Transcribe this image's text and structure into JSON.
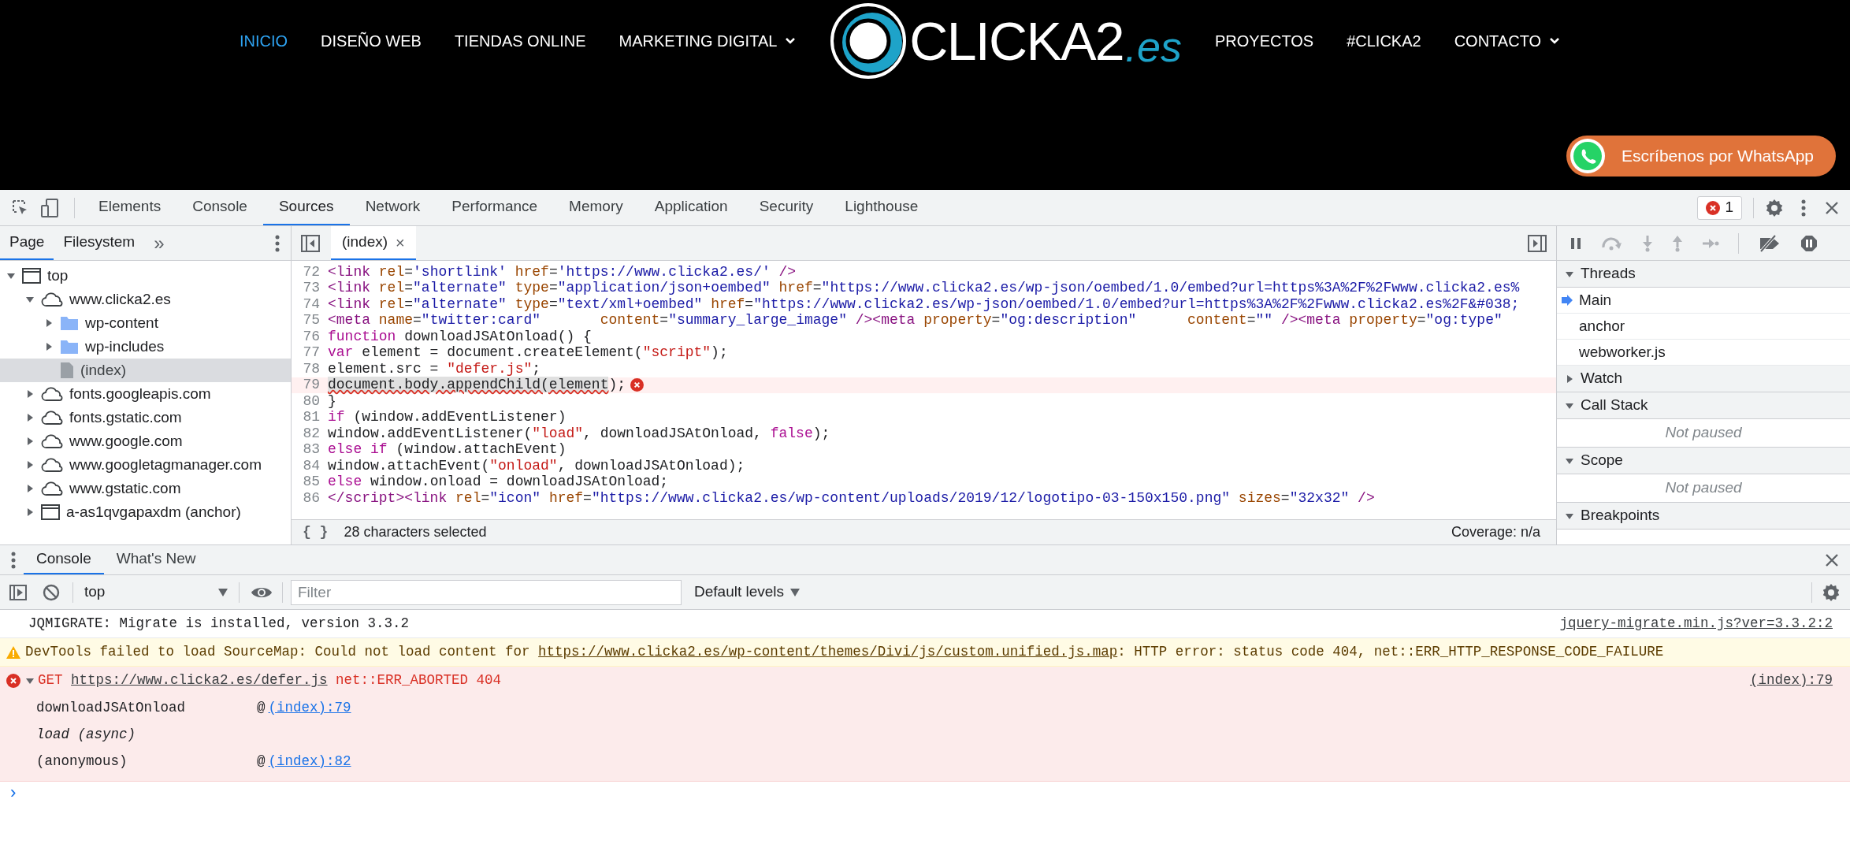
{
  "site_header": {
    "nav_left": [
      {
        "label": "INICIO",
        "selected": true,
        "has_dropdown": false
      },
      {
        "label": "DISEÑO WEB",
        "selected": false,
        "has_dropdown": false
      },
      {
        "label": "TIENDAS ONLINE",
        "selected": false,
        "has_dropdown": false
      },
      {
        "label": "MARKETING DIGITAL",
        "selected": false,
        "has_dropdown": true
      }
    ],
    "logo": {
      "name": "CLICKA2",
      "suffix": ".es"
    },
    "nav_right": [
      {
        "label": "PROYECTOS",
        "selected": false,
        "has_dropdown": false
      },
      {
        "label": "#CLICKA2",
        "selected": false,
        "has_dropdown": false
      },
      {
        "label": "CONTACTO",
        "selected": false,
        "has_dropdown": true
      }
    ],
    "whatsapp_button": "Escríbenos por WhatsApp"
  },
  "devtools": {
    "tabs": [
      {
        "label": "Elements",
        "selected": false
      },
      {
        "label": "Console",
        "selected": false
      },
      {
        "label": "Sources",
        "selected": true
      },
      {
        "label": "Network",
        "selected": false
      },
      {
        "label": "Performance",
        "selected": false
      },
      {
        "label": "Memory",
        "selected": false
      },
      {
        "label": "Application",
        "selected": false
      },
      {
        "label": "Security",
        "selected": false
      },
      {
        "label": "Lighthouse",
        "selected": false
      }
    ],
    "error_count": "1",
    "navigator": {
      "tabs": [
        {
          "label": "Page",
          "selected": true
        },
        {
          "label": "Filesystem",
          "selected": false
        }
      ],
      "more": "»",
      "tree": [
        {
          "label": "top",
          "kind": "frame",
          "expanded": true,
          "selected": false,
          "children": [
            {
              "label": "www.clicka2.es",
              "kind": "domain",
              "expanded": true,
              "selected": false,
              "children": [
                {
                  "label": "wp-content",
                  "kind": "folder",
                  "expanded": false,
                  "selected": false
                },
                {
                  "label": "wp-includes",
                  "kind": "folder",
                  "expanded": false,
                  "selected": false
                },
                {
                  "label": "(index)",
                  "kind": "file",
                  "selected": true
                }
              ]
            },
            {
              "label": "fonts.googleapis.com",
              "kind": "domain",
              "expanded": false,
              "selected": false
            },
            {
              "label": "fonts.gstatic.com",
              "kind": "domain",
              "expanded": false,
              "selected": false
            },
            {
              "label": "www.google.com",
              "kind": "domain",
              "expanded": false,
              "selected": false
            },
            {
              "label": "www.googletagmanager.com",
              "kind": "domain",
              "expanded": false,
              "selected": false
            },
            {
              "label": "www.gstatic.com",
              "kind": "domain",
              "expanded": false,
              "selected": false
            },
            {
              "label": "a-as1qvgapaxdm (anchor)",
              "kind": "frame",
              "expanded": false,
              "selected": false
            }
          ]
        }
      ]
    },
    "editor": {
      "tab": {
        "label": "(index)",
        "close": "×"
      },
      "lines": [
        {
          "number": "72",
          "error": false,
          "tokens": [
            {
              "text": "<link",
              "kind": "tag"
            },
            {
              "text": " rel",
              "kind": "attr"
            },
            {
              "text": "=",
              "kind": "plain"
            },
            {
              "text": "'shortlink'",
              "kind": "value"
            },
            {
              "text": " href",
              "kind": "attr"
            },
            {
              "text": "=",
              "kind": "plain"
            },
            {
              "text": "'https://www.clicka2.es/'",
              "kind": "value"
            },
            {
              "text": " />",
              "kind": "tag"
            }
          ]
        },
        {
          "number": "73",
          "error": false,
          "tokens": [
            {
              "text": "<link",
              "kind": "tag"
            },
            {
              "text": " rel",
              "kind": "attr"
            },
            {
              "text": "=",
              "kind": "plain"
            },
            {
              "text": "\"alternate\"",
              "kind": "value"
            },
            {
              "text": " type",
              "kind": "attr"
            },
            {
              "text": "=",
              "kind": "plain"
            },
            {
              "text": "\"application/json+oembed\"",
              "kind": "value"
            },
            {
              "text": " href",
              "kind": "attr"
            },
            {
              "text": "=",
              "kind": "plain"
            },
            {
              "text": "\"https://www.clicka2.es/wp-json/oembed/1.0/embed?url=https%3A%2F%2Fwww.clicka2.es%",
              "kind": "value"
            }
          ]
        },
        {
          "number": "74",
          "error": false,
          "tokens": [
            {
              "text": "<link",
              "kind": "tag"
            },
            {
              "text": " rel",
              "kind": "attr"
            },
            {
              "text": "=",
              "kind": "plain"
            },
            {
              "text": "\"alternate\"",
              "kind": "value"
            },
            {
              "text": " type",
              "kind": "attr"
            },
            {
              "text": "=",
              "kind": "plain"
            },
            {
              "text": "\"text/xml+oembed\"",
              "kind": "value"
            },
            {
              "text": " href",
              "kind": "attr"
            },
            {
              "text": "=",
              "kind": "plain"
            },
            {
              "text": "\"https://www.clicka2.es/wp-json/oembed/1.0/embed?url=https%3A%2F%2Fwww.clicka2.es%2F&#038;",
              "kind": "value"
            }
          ]
        },
        {
          "number": "75",
          "error": false,
          "tokens": [
            {
              "text": "<meta",
              "kind": "tag"
            },
            {
              "text": " name",
              "kind": "attr"
            },
            {
              "text": "=",
              "kind": "plain"
            },
            {
              "text": "\"twitter:card\"",
              "kind": "value"
            },
            {
              "text": "       content",
              "kind": "attr"
            },
            {
              "text": "=",
              "kind": "plain"
            },
            {
              "text": "\"summary_large_image\"",
              "kind": "value"
            },
            {
              "text": " /><meta",
              "kind": "tag"
            },
            {
              "text": " property",
              "kind": "attr"
            },
            {
              "text": "=",
              "kind": "plain"
            },
            {
              "text": "\"og:description\"",
              "kind": "value"
            },
            {
              "text": "      content",
              "kind": "attr"
            },
            {
              "text": "=",
              "kind": "plain"
            },
            {
              "text": "\"\"",
              "kind": "value"
            },
            {
              "text": " /><meta",
              "kind": "tag"
            },
            {
              "text": " property",
              "kind": "attr"
            },
            {
              "text": "=",
              "kind": "plain"
            },
            {
              "text": "\"og:type\"",
              "kind": "value"
            }
          ]
        },
        {
          "number": "76",
          "error": false,
          "tokens": [
            {
              "text": "function",
              "kind": "keyword"
            },
            {
              "text": " downloadJSAtOnload() {",
              "kind": "plain"
            }
          ]
        },
        {
          "number": "77",
          "error": false,
          "tokens": [
            {
              "text": "var",
              "kind": "keyword"
            },
            {
              "text": " element = document.createElement(",
              "kind": "plain"
            },
            {
              "text": "\"script\"",
              "kind": "string"
            },
            {
              "text": ");",
              "kind": "plain"
            }
          ]
        },
        {
          "number": "78",
          "error": false,
          "tokens": [
            {
              "text": "element.src = ",
              "kind": "plain"
            },
            {
              "text": "\"defer.js\"",
              "kind": "string"
            },
            {
              "text": ";",
              "kind": "plain"
            }
          ]
        },
        {
          "number": "79",
          "error": true,
          "tokens": [
            {
              "text": "document.body.appendChild(element",
              "kind": "selected"
            },
            {
              "text": ");",
              "kind": "plain"
            }
          ]
        },
        {
          "number": "80",
          "error": false,
          "tokens": [
            {
              "text": "}",
              "kind": "plain"
            }
          ]
        },
        {
          "number": "81",
          "error": false,
          "tokens": [
            {
              "text": "if",
              "kind": "keyword"
            },
            {
              "text": " (window.addEventListener)",
              "kind": "plain"
            }
          ]
        },
        {
          "number": "82",
          "error": false,
          "tokens": [
            {
              "text": "window.addEventListener(",
              "kind": "plain"
            },
            {
              "text": "\"load\"",
              "kind": "string"
            },
            {
              "text": ", downloadJSAtOnload, ",
              "kind": "plain"
            },
            {
              "text": "false",
              "kind": "keyword"
            },
            {
              "text": ");",
              "kind": "plain"
            }
          ]
        },
        {
          "number": "83",
          "error": false,
          "tokens": [
            {
              "text": "else if",
              "kind": "keyword"
            },
            {
              "text": " (window.attachEvent)",
              "kind": "plain"
            }
          ]
        },
        {
          "number": "84",
          "error": false,
          "tokens": [
            {
              "text": "window.attachEvent(",
              "kind": "plain"
            },
            {
              "text": "\"onload\"",
              "kind": "string"
            },
            {
              "text": ", downloadJSAtOnload);",
              "kind": "plain"
            }
          ]
        },
        {
          "number": "85",
          "error": false,
          "tokens": [
            {
              "text": "else",
              "kind": "keyword"
            },
            {
              "text": " window.onload = downloadJSAtOnload;",
              "kind": "plain"
            }
          ]
        },
        {
          "number": "86",
          "error": false,
          "tokens": [
            {
              "text": "</script><link",
              "kind": "tag"
            },
            {
              "text": " rel",
              "kind": "attr"
            },
            {
              "text": "=",
              "kind": "plain"
            },
            {
              "text": "\"icon\"",
              "kind": "value"
            },
            {
              "text": " href",
              "kind": "attr"
            },
            {
              "text": "=",
              "kind": "plain"
            },
            {
              "text": "\"https://www.clicka2.es/wp-content/uploads/2019/12/logotipo-03-150x150.png\"",
              "kind": "value"
            },
            {
              "text": " sizes",
              "kind": "attr"
            },
            {
              "text": "=",
              "kind": "plain"
            },
            {
              "text": "\"32x32\"",
              "kind": "value"
            },
            {
              "text": " />",
              "kind": "tag"
            }
          ]
        }
      ],
      "status": {
        "format_button": "{ }",
        "selection": "28 characters selected",
        "coverage": "Coverage: n/a"
      }
    },
    "debugger": {
      "sections": [
        {
          "title": "Threads",
          "expanded": true,
          "threads": [
            {
              "label": "Main",
              "selected": true
            },
            {
              "label": "anchor",
              "selected": false
            },
            {
              "label": "webworker.js",
              "selected": false
            }
          ]
        },
        {
          "title": "Watch",
          "expanded": false
        },
        {
          "title": "Call Stack",
          "expanded": true,
          "note": "Not paused"
        },
        {
          "title": "Scope",
          "expanded": true,
          "note": "Not paused"
        },
        {
          "title": "Breakpoints",
          "expanded": true
        }
      ]
    },
    "drawer": {
      "tabs": [
        {
          "label": "Console",
          "selected": true
        },
        {
          "label": "What's New",
          "selected": false
        }
      ],
      "context": "top",
      "filter_placeholder": "Filter",
      "levels": "Default levels",
      "messages": [
        {
          "kind": "log",
          "parts": [
            {
              "text": "JQMIGRATE: Migrate is installed, version 3.3.2",
              "kind": "text"
            }
          ],
          "source": "jquery-migrate.min.js?ver=3.3.2:2"
        },
        {
          "kind": "warning",
          "parts": [
            {
              "text": "DevTools failed to load SourceMap: Could not load content for ",
              "kind": "text"
            },
            {
              "text": "https://www.clicka2.es/wp-content/themes/Divi/js/custom.unified.js.map",
              "kind": "link"
            },
            {
              "text": ": HTTP error: status code 404, net::ERR_HTTP_RESPONSE_CODE_FAILURE",
              "kind": "text"
            }
          ]
        },
        {
          "kind": "error",
          "expanded": true,
          "parts": [
            {
              "text": "GET ",
              "kind": "text"
            },
            {
              "text": "https://www.clicka2.es/defer.js",
              "kind": "link"
            },
            {
              "text": " net::ERR_ABORTED 404",
              "kind": "text"
            }
          ],
          "source": "(index):79",
          "stack": [
            {
              "kind": "frame",
              "function": "downloadJSAtOnload",
              "at": "@",
              "link": "(index):79"
            },
            {
              "kind": "async",
              "function": "load (async)"
            },
            {
              "kind": "frame",
              "function": "(anonymous)",
              "at": "@",
              "link": "(index):82"
            }
          ]
        }
      ],
      "prompt": "›"
    }
  }
}
